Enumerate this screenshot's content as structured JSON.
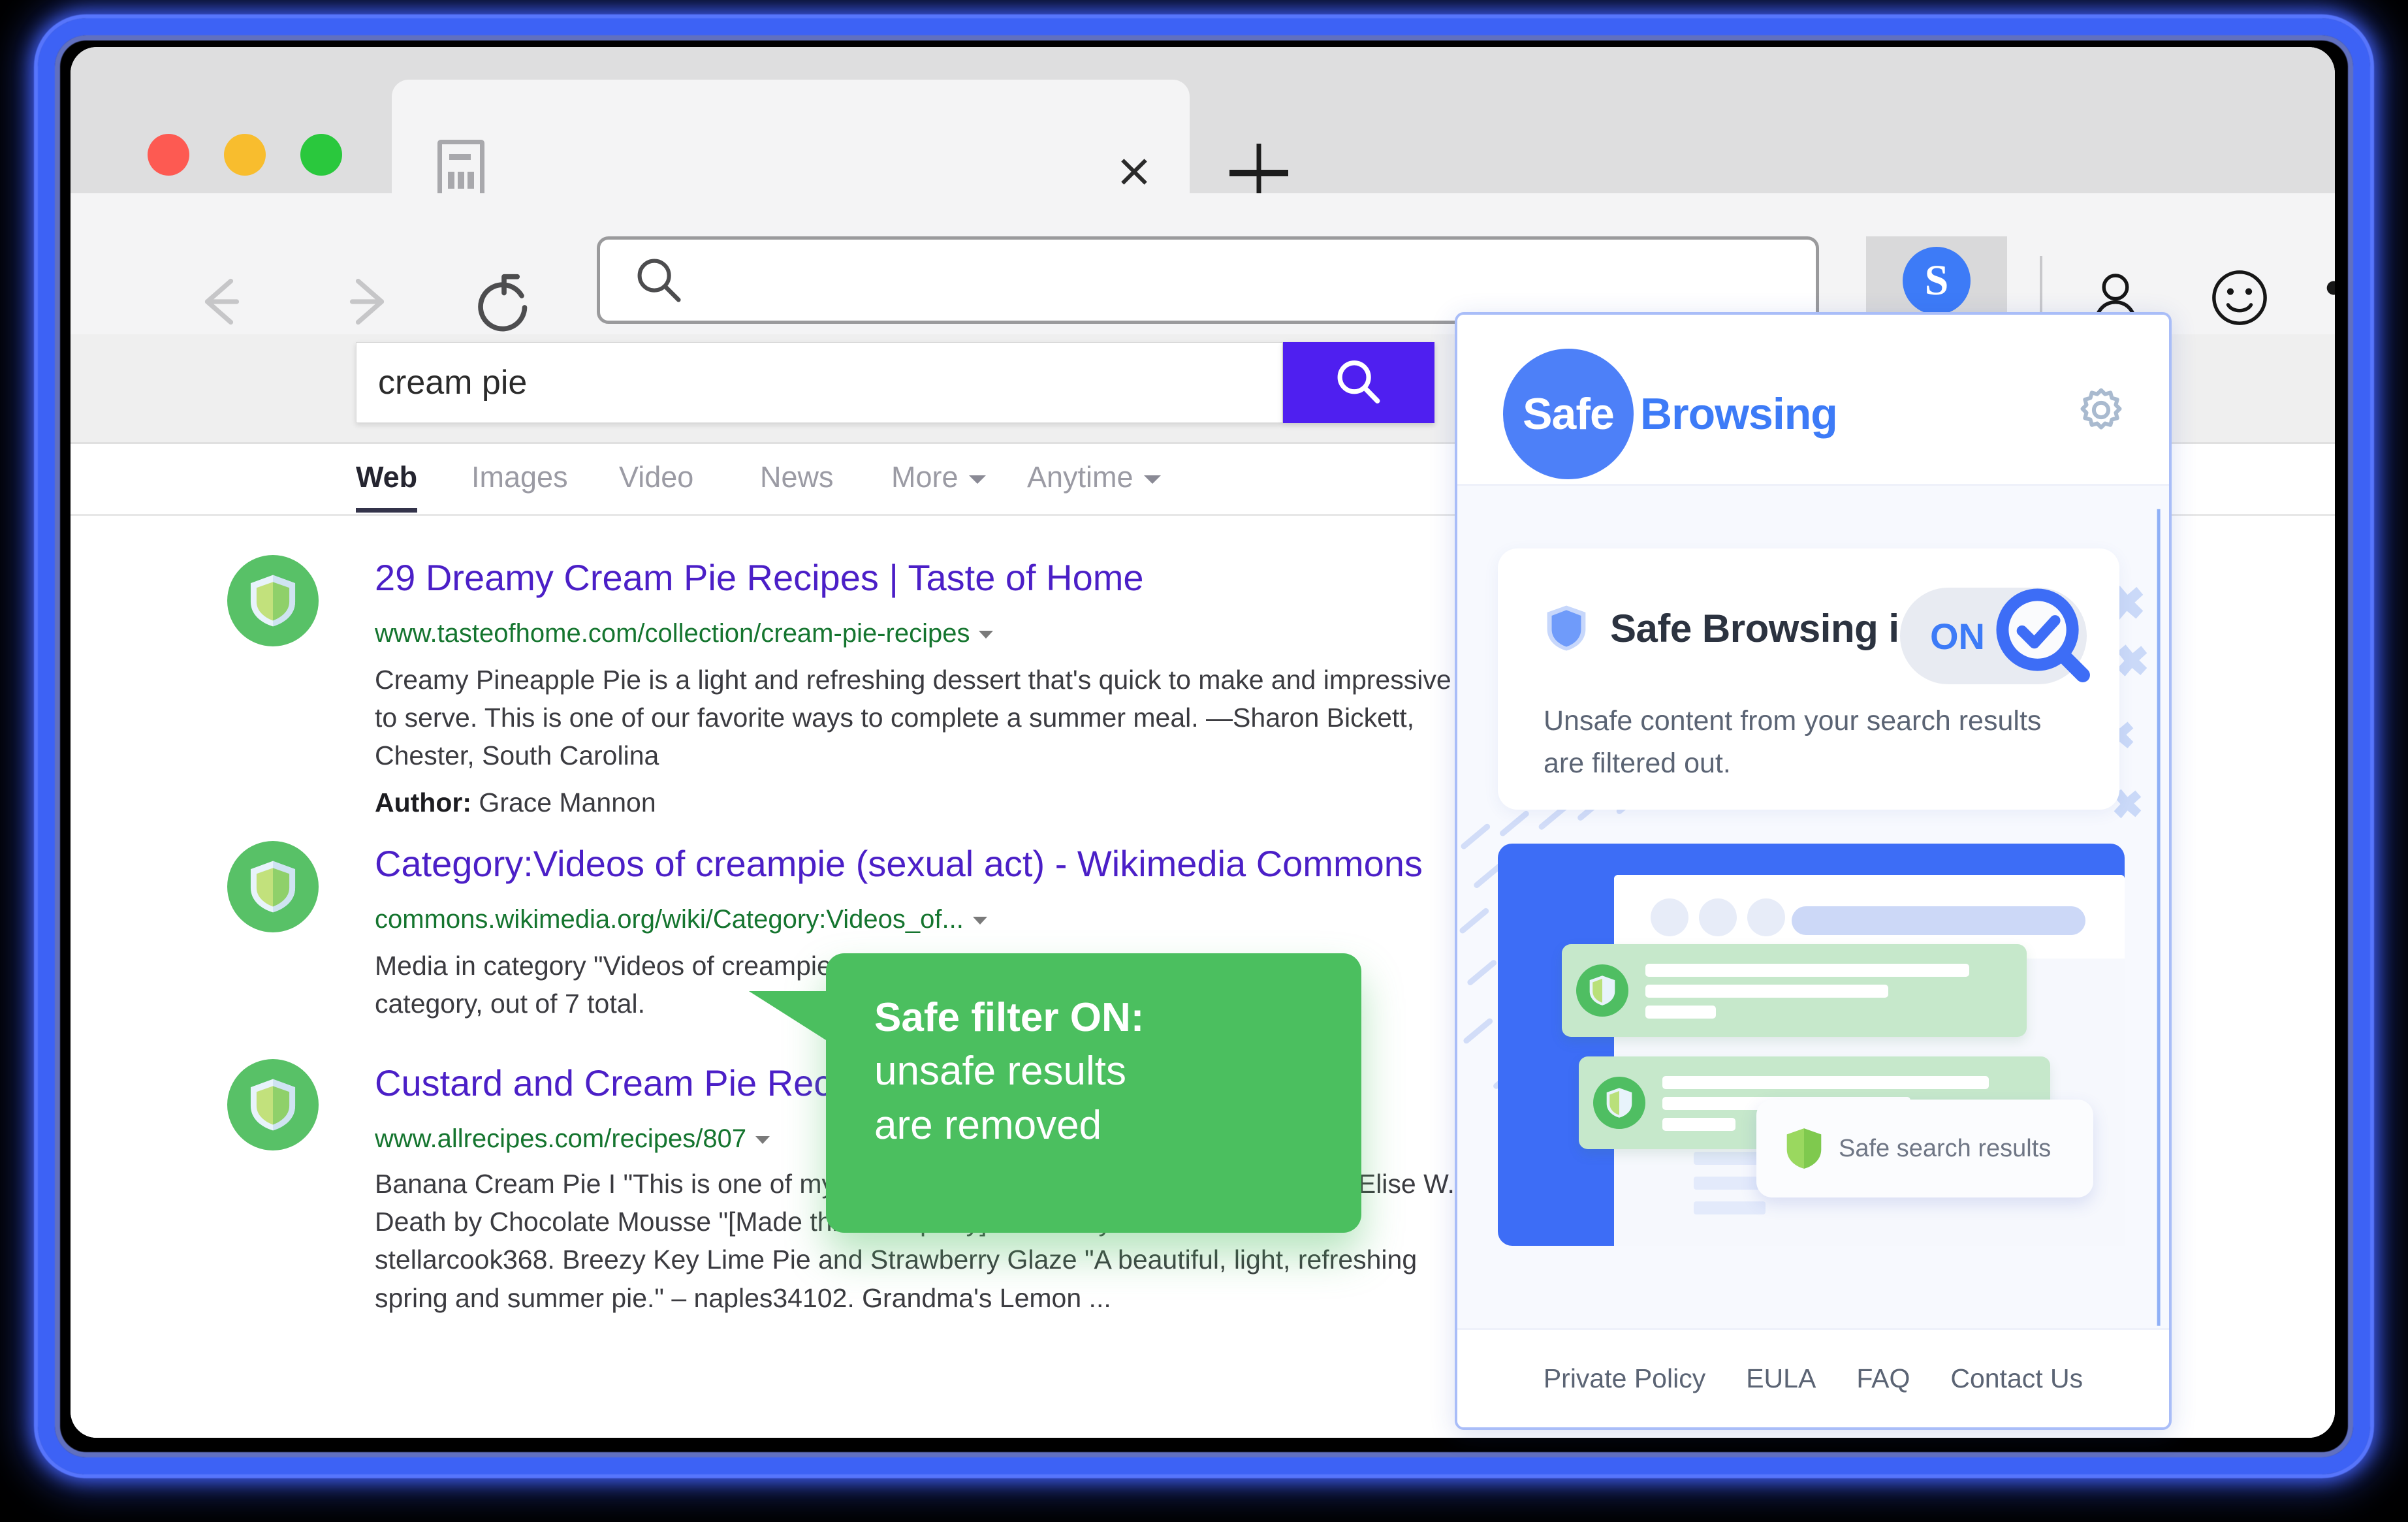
{
  "browser": {
    "tab": {
      "favicon": "page-icon",
      "close_label": "×",
      "new_tab_label": "+"
    },
    "traffic_lights": [
      "close",
      "minimize",
      "maximize"
    ],
    "nav": {
      "back": "←",
      "forward": "→",
      "reload": "↻"
    },
    "urlbar": {
      "value": "",
      "placeholder": "",
      "icon": "search-icon"
    },
    "extension": {
      "badge_letter": "S",
      "name": "Safe Browsing"
    },
    "right_icons": [
      "account-icon",
      "smiley-icon",
      "more-icon"
    ]
  },
  "search": {
    "query": "cream pie",
    "placeholder": "",
    "button_icon": "search-icon",
    "tabs": [
      {
        "label": "Web",
        "active": true,
        "dropdown": false
      },
      {
        "label": "Images",
        "active": false,
        "dropdown": false
      },
      {
        "label": "Video",
        "active": false,
        "dropdown": false
      },
      {
        "label": "News",
        "active": false,
        "dropdown": false
      },
      {
        "label": "More",
        "active": false,
        "dropdown": true
      },
      {
        "label": "Anytime",
        "active": false,
        "dropdown": true
      }
    ]
  },
  "results": [
    {
      "title": "29 Dreamy Cream Pie Recipes | Taste of Home",
      "url": "www.tasteofhome.com/collection/cream-pie-recipes",
      "description": "Creamy Pineapple Pie is a light and refreshing dessert that's quick to make and impressive to serve. This is one of our favorite ways to complete a summer meal. —Sharon Bickett, Chester, South Carolina",
      "author_label": "Author:",
      "author_name": "Grace Mannon",
      "badge": "safe-shield-icon"
    },
    {
      "title": "Category:Videos of creampie (sexual act) - Wikimedia Commons",
      "url": "commons.wikimedia.org/wiki/Category:Videos_of...",
      "description": "Media in category \"Videos of creampie (sexual act)\" The following 7 files are in this category, out of 7 total.",
      "badge": "safe-shield-icon"
    },
    {
      "title": "Custard and Cream Pie Recipes",
      "url": "www.allrecipes.com/recipes/807",
      "description": "Banana Cream Pie I \"This is one of my new favorites. So easy and so delicious!\" – Elise W. Death by Chocolate Mousse \"[Made this for a party] and everyone was thrilled.\" – stellarcook368. Breezy Key Lime Pie and Strawberry Glaze \"A beautiful, light, refreshing spring and summer pie.\" – naples34102. Grandma's Lemon ...",
      "badge": "safe-shield-icon"
    }
  ],
  "callout": {
    "line1": "Safe filter ON:",
    "line2": "unsafe results",
    "line3": "are removed",
    "color": "#4bbf5f"
  },
  "popup": {
    "logo_circle_text": "Safe",
    "logo_word_text": "Browsing",
    "gear_icon": "gear-icon",
    "status": {
      "shield_icon": "shield-icon",
      "title": "Safe Browsing is",
      "toggle_state": "ON",
      "toggle_icon": "check-magnifier-icon",
      "description": "Unsafe content from your search results are filtered out."
    },
    "illustration": {
      "chip_icon": "shield-icon",
      "chip_label": "Safe search results"
    },
    "footer_links": [
      {
        "label": "Private Policy"
      },
      {
        "label": "EULA"
      },
      {
        "label": "FAQ"
      },
      {
        "label": "Contact Us"
      }
    ]
  },
  "colors": {
    "brand_blue": "#3d7bf7",
    "search_button": "#4f1ff0",
    "safe_green": "#4bbf5f",
    "result_title": "#4b1fc7",
    "result_url": "#15752f"
  }
}
